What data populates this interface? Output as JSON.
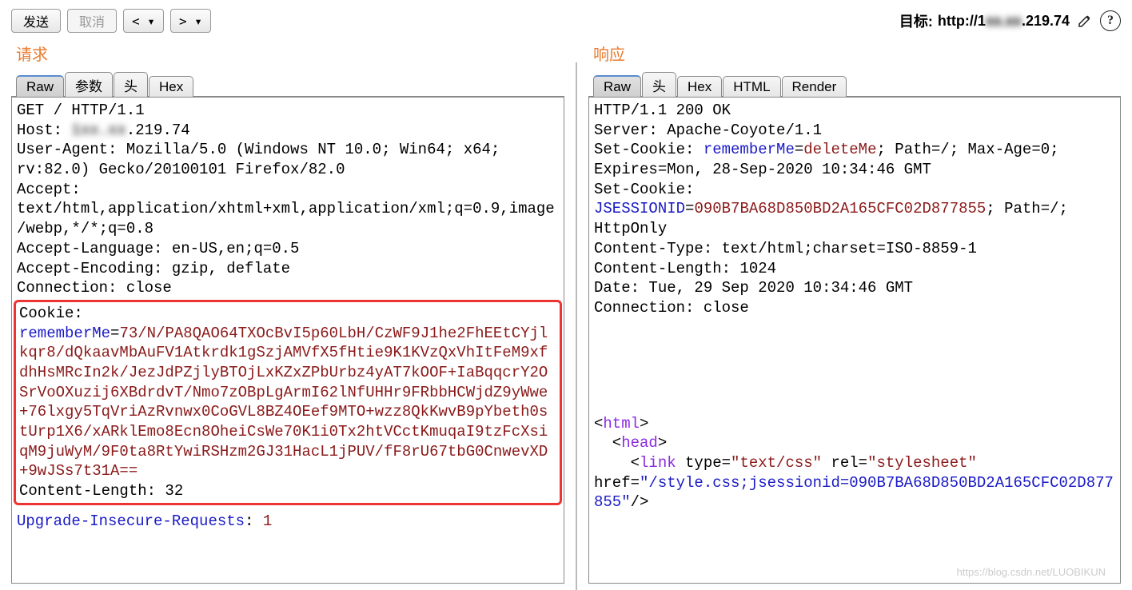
{
  "toolbar": {
    "send": "发送",
    "cancel": "取消",
    "prev": "< ▾",
    "next": "> ▾"
  },
  "target": {
    "label": "目标: ",
    "url_prefix": "http://1",
    "url_blur": "xx.xx",
    "url_suffix": ".219.74"
  },
  "request": {
    "title": "请求",
    "tabs": [
      "Raw",
      "参数",
      "头",
      "Hex"
    ],
    "line1": "GET / HTTP/1.1",
    "host_label": "Host: ",
    "host_blur": "1xx.xx",
    "host_suffix": ".219.74",
    "ua": "User-Agent: Mozilla/5.0 (Windows NT 10.0; Win64; x64; rv:82.0) Gecko/20100101 Firefox/82.0",
    "accept": "Accept: text/html,application/xhtml+xml,application/xml;q=0.9,image/webp,*/*;q=0.8",
    "accept_lang": "Accept-Language: en-US,en;q=0.5",
    "accept_enc": "Accept-Encoding: gzip, deflate",
    "conn": "Connection: close",
    "cookie_label": "Cookie:",
    "cookie_name": "rememberMe",
    "eq": "=",
    "cookie_value": "73/N/PA8QAO64TXOcBvI5p60LbH/CzWF9J1he2FhEEtCYjlkqr8/dQkaavMbAuFV1Atkrdk1gSzjAMVfX5fHtie9K1KVzQxVhItFeM9xfdhHsMRcIn2k/JezJdPZjlyBTOjLxKZxZPbUrbz4yAT7kOOF+IaBqqcrY2OSrVoOXuzij6XBdrdvT/Nmo7zOBpLgArmI62lNfUHHr9FRbbHCWjdZ9yWwe+76lxgy5TqVriAzRvnwx0CoGVL8BZ4OEef9MTO+wzz8QkKwvB9pYbeth0stUrp1X6/xARklEmo8Ecn8OheiCsWe70K1i0Tx2htVCctKmuqaI9tzFcXsiqM9juWyM/9F0ta8RtYwiRSHzm2GJ31HacL1jPUV/fF8rU67tbG0CnwevXD+9wJSs7t31A==",
    "clen": "Content-Length: 32",
    "uir_name": "Upgrade-Insecure-Requests",
    "uir_val": "1",
    "colon": ": "
  },
  "response": {
    "title": "响应",
    "tabs": [
      "Raw",
      "头",
      "Hex",
      "HTML",
      "Render"
    ],
    "line1": "HTTP/1.1 200 OK",
    "server": "Server: Apache-Coyote/1.1",
    "sc1_prefix": "Set-Cookie: ",
    "sc1_name": "rememberMe",
    "sc1_eq": "=",
    "sc1_val": "deleteMe",
    "sc1_rest": "; Path=/; Max-Age=0; Expires=Mon, 28-Sep-2020 10:34:46 GMT",
    "sc2_prefix": "Set-Cookie: ",
    "sc2_name": "JSESSIONID",
    "sc2_eq": "=",
    "sc2_val": "090B7BA68D850BD2A165CFC02D877855",
    "sc2_rest": "; Path=/; HttpOnly",
    "ctype": "Content-Type: text/html;charset=ISO-8859-1",
    "clen": "Content-Length: 1024",
    "date": "Date: Tue, 29 Sep 2020 10:34:46 GMT",
    "conn": "Connection: close",
    "html_open": "html",
    "head_open": "head",
    "link_tag": "link",
    "link_type_attr": " type=",
    "link_type_val": "\"text/css\"",
    "link_rel_attr": " rel=",
    "link_rel_val": "\"stylesheet\"",
    "link_href_attr": " href=",
    "link_href_val": "\"/style.css;jsessionid=090B7BA68D850BD2A165CFC02D877855\"",
    "slash_close": "/>"
  },
  "watermark": "https://blog.csdn.net/LUOBIKUN"
}
